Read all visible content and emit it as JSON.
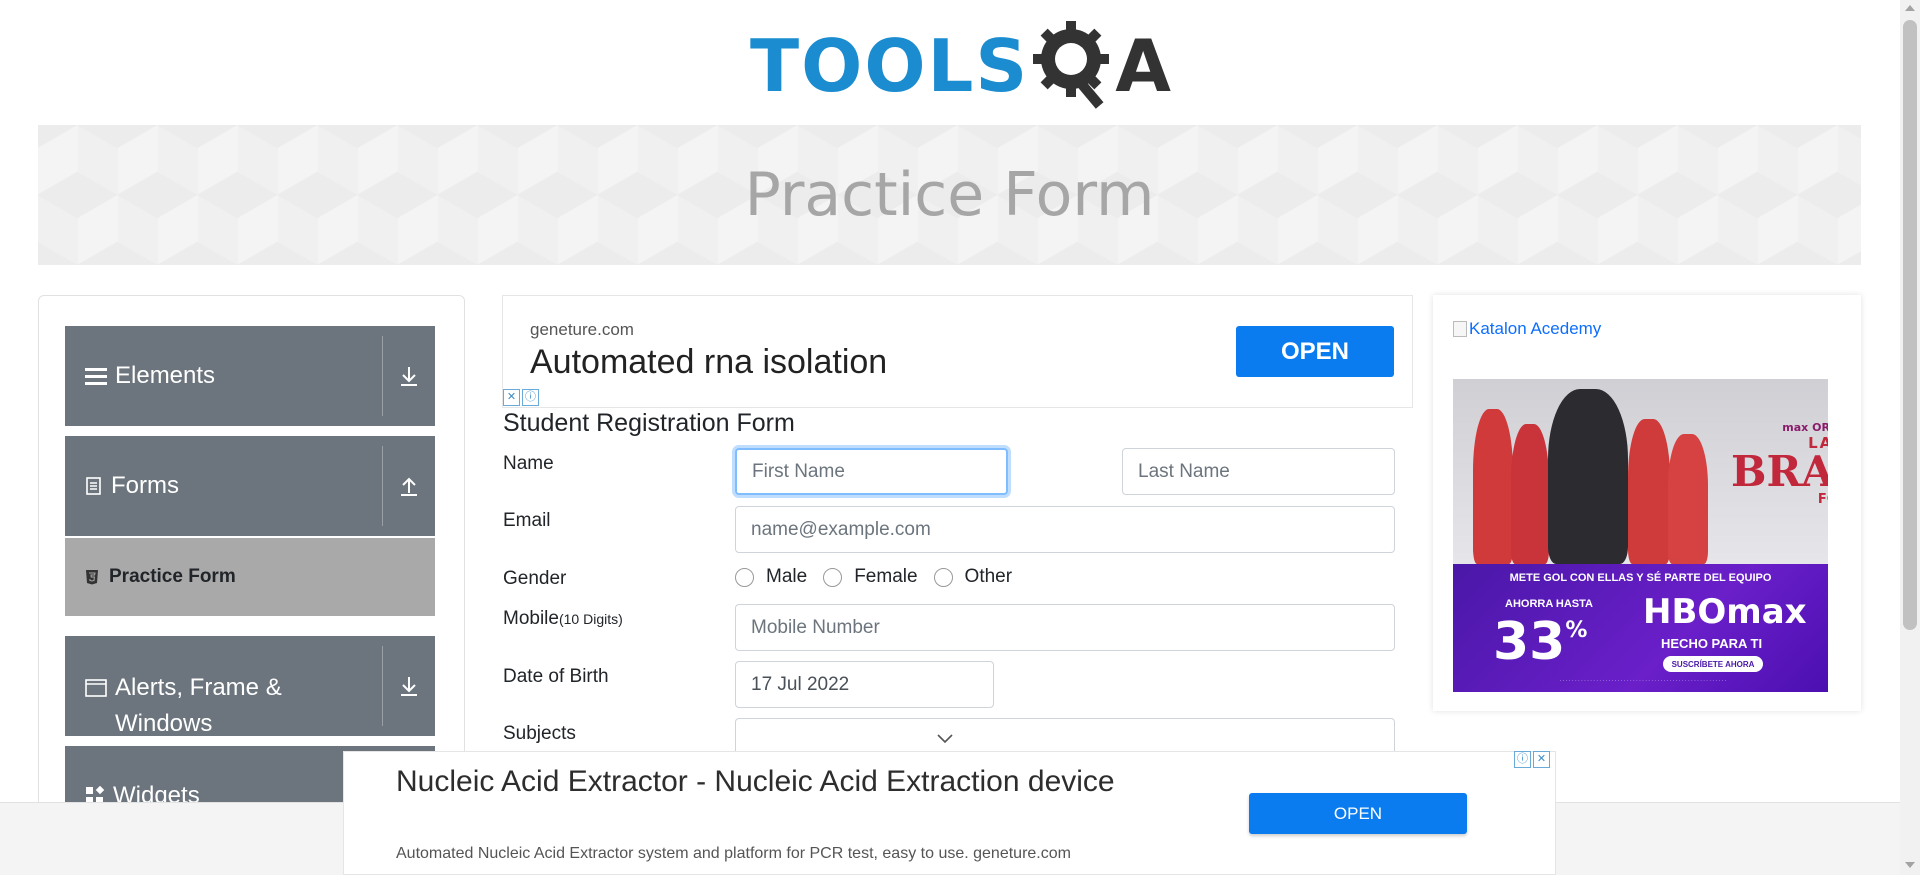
{
  "header": {
    "logo_tools": "TOOLS",
    "logo_a": "A",
    "page_title": "Practice Form"
  },
  "sidebar": {
    "groups": [
      {
        "label": "Elements",
        "icon": "hamburger-icon",
        "toggle_icon": "download-arrow-icon"
      },
      {
        "label": "Forms",
        "icon": "document-icon",
        "toggle_icon": "upload-arrow-icon"
      },
      {
        "label": "Alerts, Frame & Windows",
        "icon": "window-icon",
        "toggle_icon": "download-arrow-icon"
      },
      {
        "label": "Widgets",
        "icon": "widgets-icon"
      }
    ],
    "active_item": {
      "label": "Practice Form",
      "icon": "html5-icon"
    }
  },
  "top_ad": {
    "domain": "geneture.com",
    "headline": "Automated rna isolation",
    "button": "OPEN"
  },
  "form": {
    "title": "Student Registration Form",
    "name_label": "Name",
    "first_name_placeholder": "First Name",
    "last_name_placeholder": "Last Name",
    "email_label": "Email",
    "email_placeholder": "name@example.com",
    "gender_label": "Gender",
    "gender_options": [
      "Male",
      "Female",
      "Other"
    ],
    "mobile_label": "Mobile",
    "mobile_hint": "(10 Digits)",
    "mobile_placeholder": "Mobile Number",
    "dob_label": "Date of Birth",
    "dob_value": "17 Jul 2022",
    "subjects_label": "Subjects"
  },
  "right_ad": {
    "image_alt": "Katalon Acedemy",
    "hbo_top_small": "max ORIGINAL",
    "hbo_las": "LAS",
    "hbo_bravas": "BRAVAS",
    "hbo_fc": "FC",
    "hbo_line": "METE GOL CON ELLAS Y SÉ PARTE DEL EQUIPO",
    "hbo_ahora": "AHORRA HASTA",
    "hbo_percent": "33",
    "hbo_percent_sign": "%",
    "hbo_logo": "HBOmax",
    "hbo_tagline": "HECHO PARA TI",
    "hbo_button": "SUSCRÍBETE AHORA"
  },
  "bottom_ad": {
    "headline": "Nucleic Acid Extractor - Nucleic Acid Extraction device",
    "description": "Automated Nucleic Acid Extractor system and platform for PCR test, easy to use. geneture.com",
    "button": "OPEN"
  },
  "colors": {
    "logo_blue": "#1a8ccf",
    "sidebar_group": "#6c757d",
    "active_item": "#a9a9a9",
    "ad_button": "#0a7cf0"
  }
}
